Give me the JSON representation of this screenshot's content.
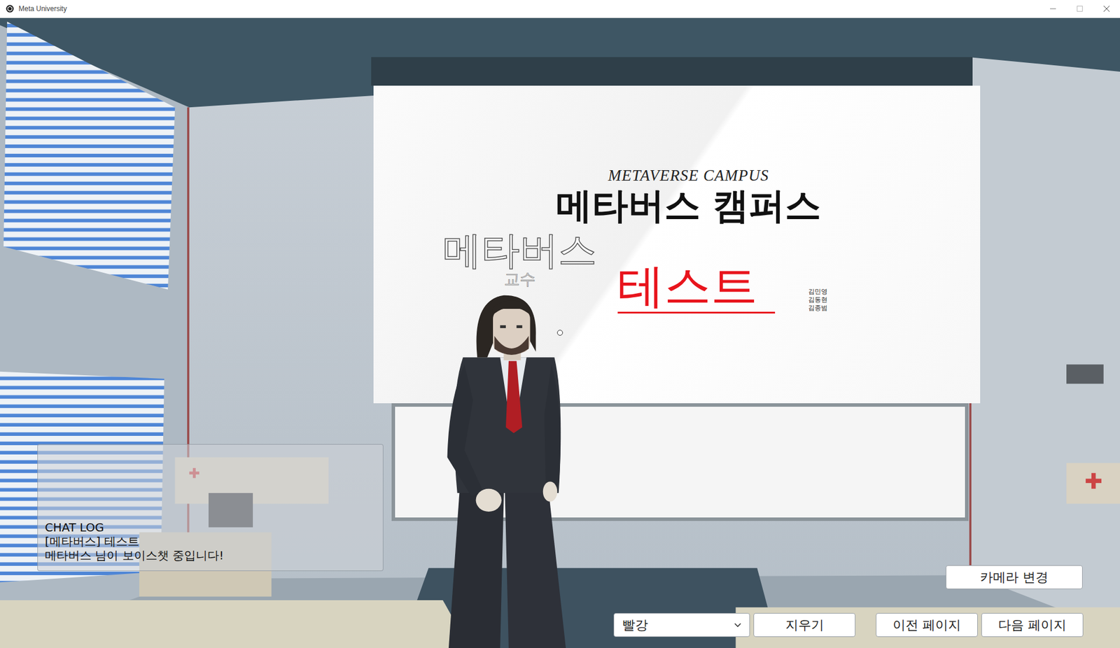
{
  "window": {
    "title": "Meta University"
  },
  "slide": {
    "subtitle": "METAVERSE CAMPUS",
    "title": "메타버스 캠퍼스",
    "members": [
      "김민영",
      "김동현",
      "김종범"
    ]
  },
  "annotation": {
    "text": "테스트"
  },
  "avatar": {
    "name": "메타버스",
    "role": "교수"
  },
  "chat": {
    "title": "CHAT LOG",
    "lines": [
      "[메타버스] 테스트",
      "메타버스 님이 보이스챗 중입니다!"
    ]
  },
  "controls": {
    "camera_button": "카메라 변경",
    "color_select": {
      "value": "빨강"
    },
    "buttons": [
      "지우기",
      "이전 페이지",
      "다음 페이지"
    ]
  }
}
